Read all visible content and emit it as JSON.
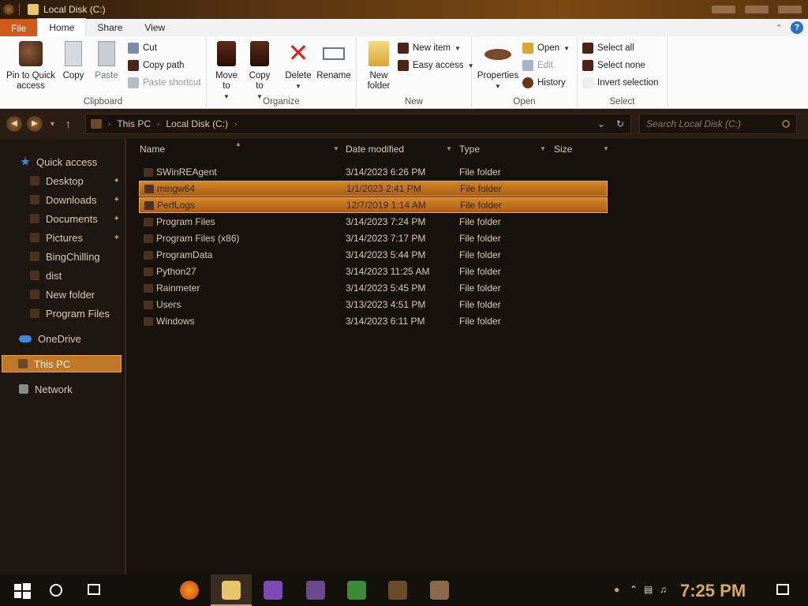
{
  "window": {
    "title": "Local Disk (C:)"
  },
  "ribbon_tabs": [
    "File",
    "Home",
    "Share",
    "View"
  ],
  "ribbon": {
    "clipboard": {
      "label": "Clipboard",
      "pin": "Pin to Quick access",
      "copy": "Copy",
      "paste": "Paste",
      "cut": "Cut",
      "copy_path": "Copy path",
      "paste_shortcut": "Paste shortcut"
    },
    "organize": {
      "label": "Organize",
      "move_to": "Move to",
      "copy_to": "Copy to",
      "delete": "Delete",
      "rename": "Rename"
    },
    "new": {
      "label": "New",
      "new_folder": "New folder",
      "new_item": "New item",
      "easy_access": "Easy access"
    },
    "open": {
      "label": "Open",
      "properties": "Properties",
      "open": "Open",
      "edit": "Edit",
      "history": "History"
    },
    "select": {
      "label": "Select",
      "select_all": "Select all",
      "select_none": "Select none",
      "invert": "Invert selection"
    }
  },
  "address": {
    "crumbs": [
      "This PC",
      "Local Disk (C:)"
    ],
    "search_placeholder": "Search Local Disk (C:)"
  },
  "sidebar": {
    "quick_access": "Quick access",
    "items": [
      "Desktop",
      "Downloads",
      "Documents",
      "Pictures",
      "BingChilling",
      "dist",
      "New folder",
      "Program Files"
    ],
    "onedrive": "OneDrive",
    "this_pc": "This PC",
    "network": "Network"
  },
  "columns": [
    "Name",
    "Date modified",
    "Type",
    "Size"
  ],
  "files": [
    {
      "name": "SWinREAgent",
      "date": "3/14/2023 6:26 PM",
      "type": "File folder"
    },
    {
      "name": "mingw64",
      "date": "1/1/2023 2:41 PM",
      "type": "File folder"
    },
    {
      "name": "PerfLogs",
      "date": "12/7/2019 1:14 AM",
      "type": "File folder"
    },
    {
      "name": "Program Files",
      "date": "3/14/2023 7:24 PM",
      "type": "File folder"
    },
    {
      "name": "Program Files (x86)",
      "date": "3/14/2023 7:17 PM",
      "type": "File folder"
    },
    {
      "name": "ProgramData",
      "date": "3/14/2023 5:44 PM",
      "type": "File folder"
    },
    {
      "name": "Python27",
      "date": "3/14/2023 11:25 AM",
      "type": "File folder"
    },
    {
      "name": "Rainmeter",
      "date": "3/14/2023 5:45 PM",
      "type": "File folder"
    },
    {
      "name": "Users",
      "date": "3/13/2023 4:51 PM",
      "type": "File folder"
    },
    {
      "name": "Windows",
      "date": "3/14/2023 6:11 PM",
      "type": "File folder"
    }
  ],
  "taskbar": {
    "clock": "7:25 PM"
  },
  "colors": {
    "accent": "#c07828",
    "file_tab": "#d05a1a"
  }
}
